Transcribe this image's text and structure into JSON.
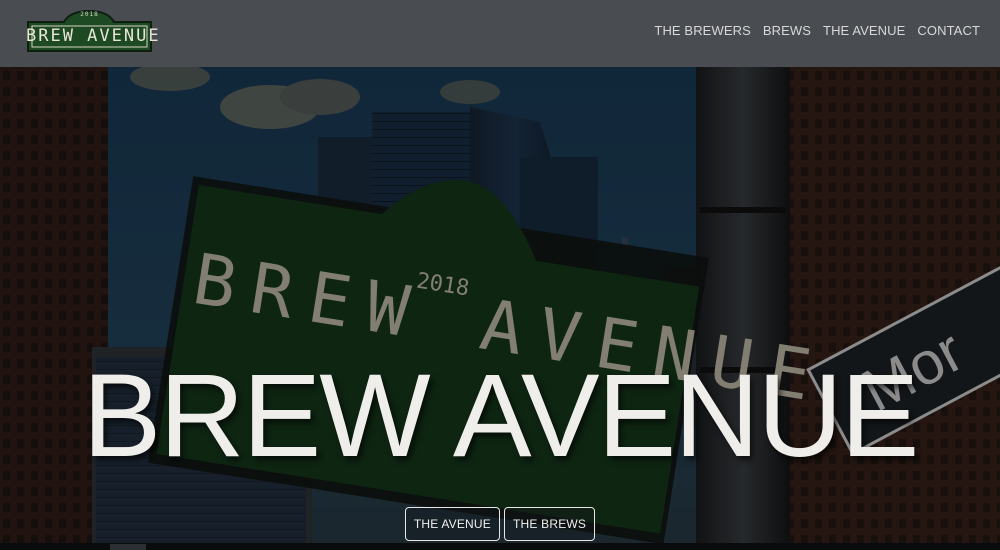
{
  "header": {
    "logo": {
      "year": "2018",
      "text": "BREW AVENUE",
      "colors": {
        "green": "#1d4a22",
        "frame": "#0e1f10",
        "text": "#e8e4d6"
      }
    },
    "nav": [
      {
        "label": "THE BREWERS"
      },
      {
        "label": "BREWS"
      },
      {
        "label": "THE AVENUE"
      },
      {
        "label": "CONTACT"
      }
    ]
  },
  "hero": {
    "title": "BREW AVENUE",
    "sign_year": "2018",
    "sign_text": "BREW AVENUE",
    "street_sign_text": "Mor",
    "buttons": [
      {
        "label": "THE AVENUE"
      },
      {
        "label": "THE BREWS"
      }
    ]
  },
  "colors": {
    "header_bg": "#494c51",
    "nav_text": "#d8d8d8",
    "sky": "#1e3f5a",
    "sign_green": "#163a1c"
  }
}
